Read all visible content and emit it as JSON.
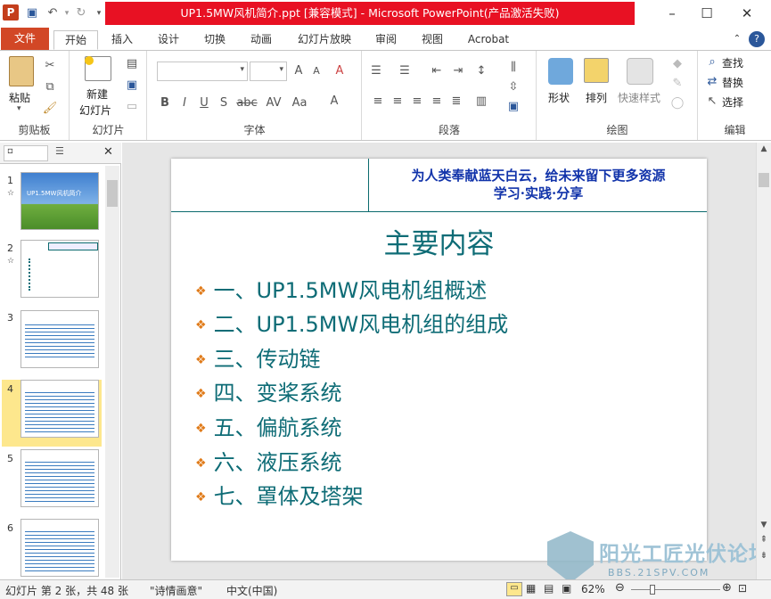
{
  "window": {
    "title": "UP1.5MW风机简介.ppt [兼容模式] - Microsoft PowerPoint(产品激活失败)",
    "app_icon": "P"
  },
  "tabs": [
    "文件",
    "开始",
    "插入",
    "设计",
    "切换",
    "动画",
    "幻灯片放映",
    "审阅",
    "视图",
    "Acrobat"
  ],
  "ribbon": {
    "clipboard": {
      "label": "剪贴板",
      "paste": "粘贴"
    },
    "slides": {
      "label": "幻灯片",
      "new_slide_line1": "新建",
      "new_slide_line2": "幻灯片"
    },
    "font": {
      "label": "字体"
    },
    "paragraph": {
      "label": "段落"
    },
    "drawing": {
      "label": "绘图",
      "shape": "形状",
      "arrange": "排列",
      "quick_styles": "快速样式"
    },
    "editing": {
      "label": "编辑",
      "find": "查找",
      "replace": "替换",
      "select": "选择"
    }
  },
  "slides_pane": {
    "numbers": [
      "1",
      "2",
      "3",
      "4",
      "5",
      "6"
    ],
    "thumb1_title": "UP1.5MW风机简介"
  },
  "slide": {
    "header_line1": "为人类奉献蓝天白云，给未来留下更多资源",
    "header_line2": "学习·实践·分享",
    "title": "主要内容",
    "bullets": [
      "一、UP1.5MW风电机组概述",
      "二、UP1.5MW风电机组的组成",
      "三、传动链",
      "四、变桨系统",
      "五、偏航系统",
      "六、液压系统",
      "七、罩体及塔架"
    ],
    "bullet_color": "#0e6c76",
    "bullet_marker_color": "#e07b1a"
  },
  "statusbar": {
    "slide_info": "幻灯片 第 2 张，共 48 张",
    "theme": "\"诗情画意\"",
    "language": "中文(中国)",
    "zoom": "62%"
  },
  "watermark": {
    "brand": "阳光工匠光伏论坛",
    "url": "BBS.21SPV.COM"
  }
}
